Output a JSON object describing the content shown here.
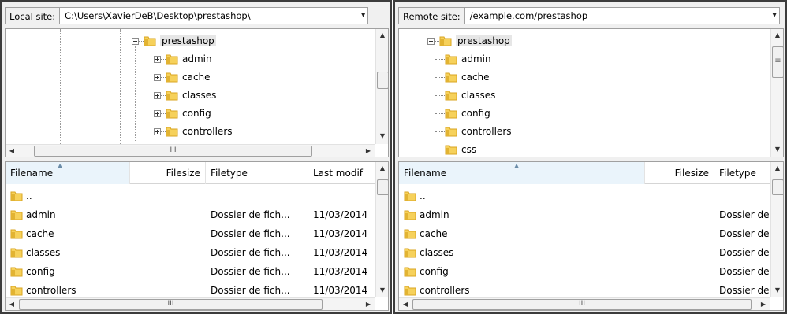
{
  "local": {
    "site_label": "Local site:",
    "site_path": "C:\\Users\\XavierDeB\\Desktop\\prestashop\\",
    "tree_root": "prestashop",
    "tree_children": [
      "admin",
      "cache",
      "classes",
      "config",
      "controllers"
    ],
    "columns": [
      "Filename",
      "Filesize",
      "Filetype",
      "Last modif"
    ],
    "files": [
      {
        "name": "..",
        "type": "",
        "modified": ""
      },
      {
        "name": "admin",
        "type": "Dossier de fich...",
        "modified": "11/03/2014"
      },
      {
        "name": "cache",
        "type": "Dossier de fich...",
        "modified": "11/03/2014"
      },
      {
        "name": "classes",
        "type": "Dossier de fich...",
        "modified": "11/03/2014"
      },
      {
        "name": "config",
        "type": "Dossier de fich...",
        "modified": "11/03/2014"
      },
      {
        "name": "controllers",
        "type": "Dossier de fich...",
        "modified": "11/03/2014"
      }
    ]
  },
  "remote": {
    "site_label": "Remote site:",
    "site_path": "/example.com/prestashop",
    "tree_root": "prestashop",
    "tree_children": [
      "admin",
      "cache",
      "classes",
      "config",
      "controllers",
      "css"
    ],
    "columns": [
      "Filename",
      "Filesize",
      "Filetype"
    ],
    "files": [
      {
        "name": "..",
        "type": ""
      },
      {
        "name": "admin",
        "type": "Dossier de"
      },
      {
        "name": "cache",
        "type": "Dossier de"
      },
      {
        "name": "classes",
        "type": "Dossier de"
      },
      {
        "name": "config",
        "type": "Dossier de"
      },
      {
        "name": "controllers",
        "type": "Dossier de"
      }
    ]
  },
  "glyphs": {
    "dropdown": "▾",
    "scroll_up": "▲",
    "scroll_down": "▼",
    "scroll_left": "◀",
    "scroll_right": "▶",
    "sort_asc": "▲",
    "thumb_grip": "III",
    "thumb_grip_v": "≡"
  },
  "icons": {
    "folder": "folder-icon",
    "expand": "expand-icon",
    "collapse": "collapse-icon"
  },
  "colors": {
    "folder_fill": "#f6d15b",
    "folder_shade": "#d9a521",
    "sorted_header": "#eaf4fb"
  }
}
